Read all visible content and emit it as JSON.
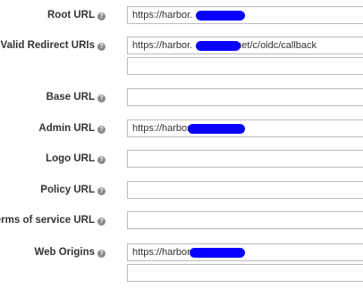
{
  "colors": {
    "redaction": "#0a00ff",
    "required": "#cc0000",
    "border": "#bbbbbb"
  },
  "help_icon_glyph": "?",
  "required_marker": "*",
  "fields": {
    "root_url": {
      "label": "Root URL",
      "value": "https://harbor.         net"
    },
    "valid_redirect_uris": {
      "label": "Valid Redirect URIs",
      "value": "https://harbor.               .net/c/oidc/callback",
      "value2": ""
    },
    "base_url": {
      "label": "Base URL",
      "value": ""
    },
    "admin_url": {
      "label": "Admin URL",
      "value": "https://harbor.            net"
    },
    "logo_url": {
      "label": "Logo URL",
      "value": ""
    },
    "policy_url": {
      "label": "Policy URL",
      "value": ""
    },
    "terms_url": {
      "label": "Terms of service URL",
      "value": ""
    },
    "web_origins": {
      "label": "Web Origins",
      "value": "https://harbor.            net",
      "value2": ""
    }
  }
}
